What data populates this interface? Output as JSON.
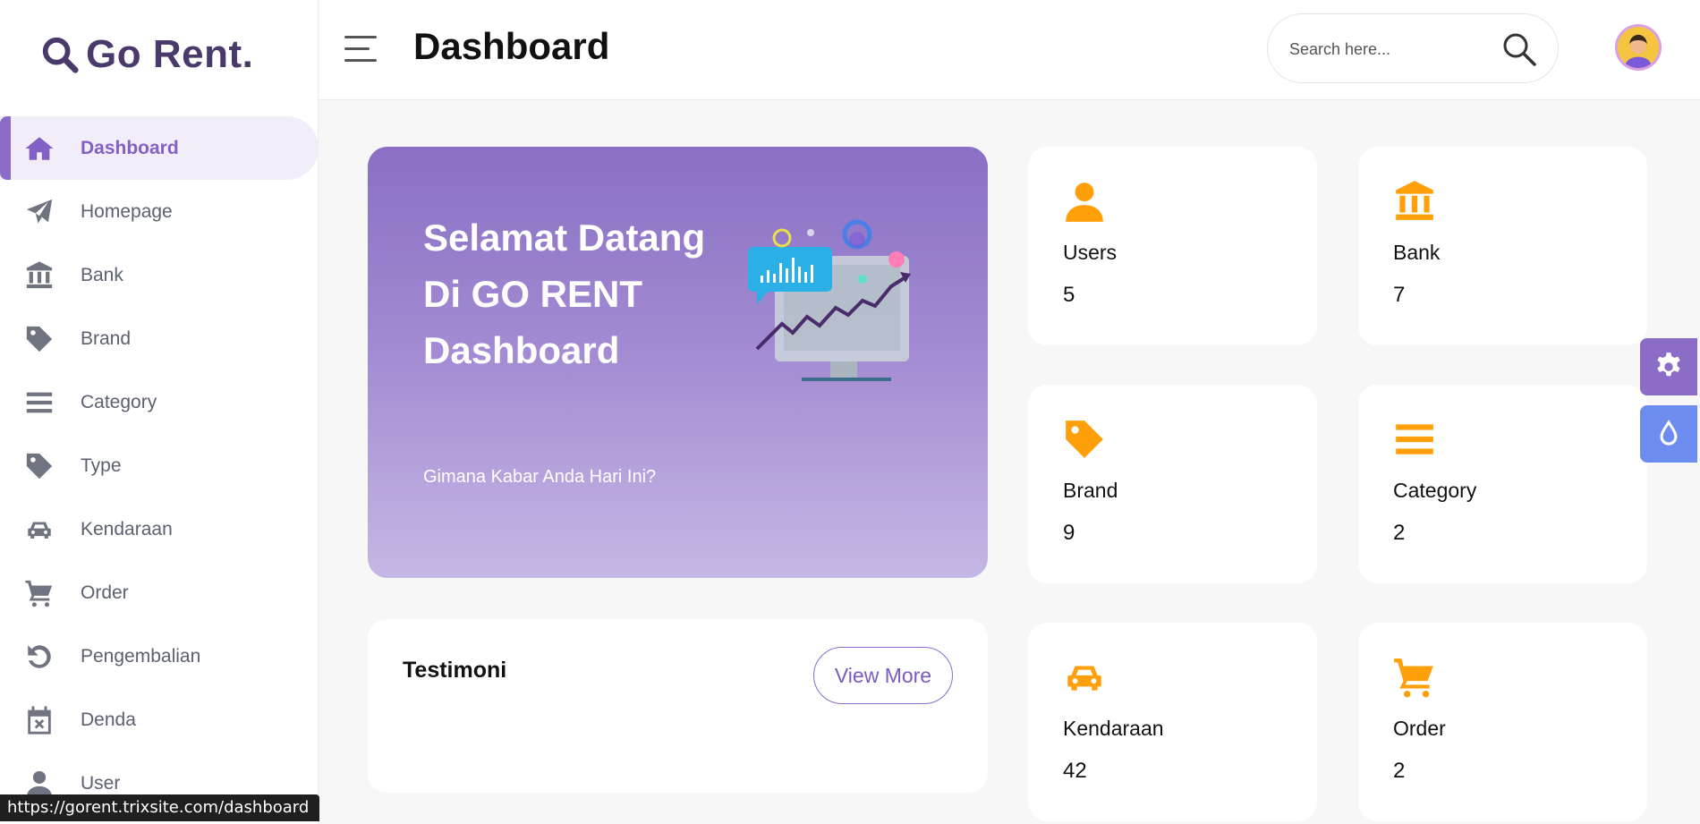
{
  "app": {
    "name": "Go Rent."
  },
  "sidebar": {
    "items": [
      {
        "label": "Dashboard",
        "icon": "home-icon",
        "active": true
      },
      {
        "label": "Homepage",
        "icon": "paper-plane-icon"
      },
      {
        "label": "Bank",
        "icon": "bank-icon"
      },
      {
        "label": "Brand",
        "icon": "tag-icon"
      },
      {
        "label": "Category",
        "icon": "list-icon"
      },
      {
        "label": "Type",
        "icon": "tag-icon"
      },
      {
        "label": "Kendaraan",
        "icon": "car-icon"
      },
      {
        "label": "Order",
        "icon": "cart-icon"
      },
      {
        "label": "Pengembalian",
        "icon": "undo-icon"
      },
      {
        "label": "Denda",
        "icon": "calendar-x-icon"
      },
      {
        "label": "User",
        "icon": "user-icon"
      }
    ]
  },
  "header": {
    "title": "Dashboard",
    "search_placeholder": "Search here..."
  },
  "banner": {
    "title": "Selamat Datang Di GO RENT Dashboard",
    "subtitle": "Gimana Kabar Anda Hari Ini?"
  },
  "testimoni": {
    "title": "Testimoni",
    "button": "View More"
  },
  "stats": [
    {
      "label": "Users",
      "value": "5",
      "icon": "user-icon"
    },
    {
      "label": "Bank",
      "value": "7",
      "icon": "bank-icon"
    },
    {
      "label": "Brand",
      "value": "9",
      "icon": "tag-icon"
    },
    {
      "label": "Category",
      "value": "2",
      "icon": "list-icon"
    },
    {
      "label": "Kendaraan",
      "value": "42",
      "icon": "car-icon"
    },
    {
      "label": "Order",
      "value": "2",
      "icon": "cart-icon"
    }
  ],
  "status_url": "https://gorent.trixsite.com/dashboard",
  "colors": {
    "accent": "#8b6cc7",
    "stat_icon": "#ff9f0a",
    "settings_button": "#8b6cc7",
    "theme_button": "#6c8cf0"
  }
}
